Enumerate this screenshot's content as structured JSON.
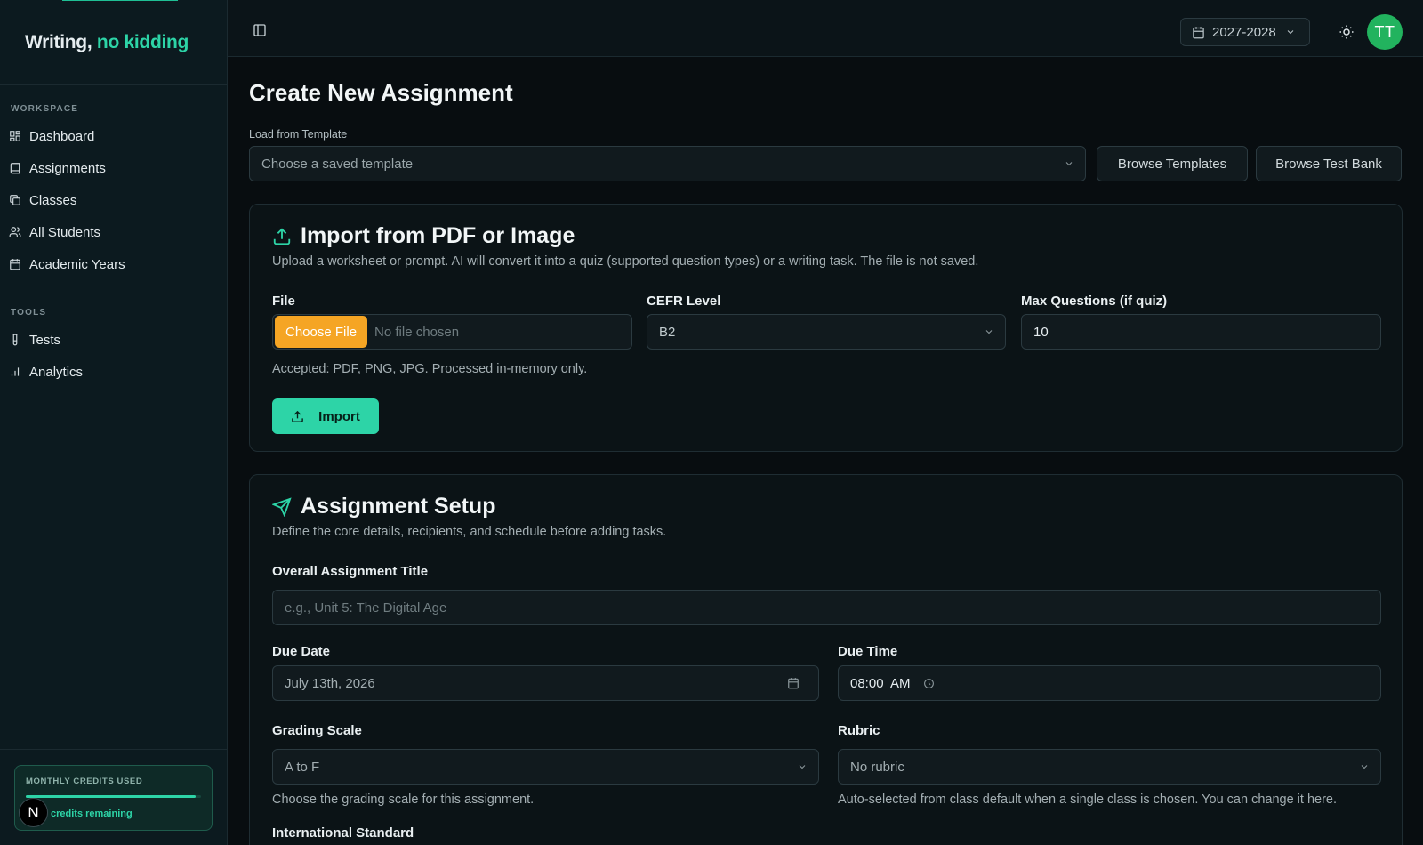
{
  "brand": {
    "text": "Writing,",
    "accent": "no kidding",
    "accent_color": "#2dd4a7"
  },
  "sidebar": {
    "workspace_label": "WORKSPACE",
    "workspace_items": [
      {
        "label": "Dashboard",
        "icon": "dashboard-icon"
      },
      {
        "label": "Assignments",
        "icon": "book-icon"
      },
      {
        "label": "Classes",
        "icon": "copy-icon"
      },
      {
        "label": "All Students",
        "icon": "users-icon"
      },
      {
        "label": "Academic Years",
        "icon": "calendar-icon"
      }
    ],
    "tools_label": "TOOLS",
    "tools_items": [
      {
        "label": "Tests",
        "icon": "test-tube-icon"
      },
      {
        "label": "Analytics",
        "icon": "bar-chart-icon"
      }
    ],
    "credits": {
      "label": "MONTHLY CREDITS USED",
      "remaining": "credits remaining",
      "used_fraction": 0.97
    },
    "user_initial": "N"
  },
  "header": {
    "academic_year": "2027-2028",
    "avatar_initials": "TT",
    "avatar_color": "#22b35e"
  },
  "page": {
    "title": "Create New Assignment",
    "template_label": "Load from Template",
    "template_placeholder": "Choose a saved template",
    "browse_templates": "Browse Templates",
    "browse_test_bank": "Browse Test Bank"
  },
  "import_card": {
    "title": "Import from PDF or Image",
    "description": "Upload a worksheet or prompt. AI will convert it into a quiz (supported question types) or a writing task. The file is not saved.",
    "file_label": "File",
    "choose_file": "Choose File",
    "no_file": "No file chosen",
    "cefr_label": "CEFR Level",
    "cefr_value": "B2",
    "max_q_label": "Max Questions (if quiz)",
    "max_q_value": "10",
    "accepted": "Accepted: PDF, PNG, JPG. Processed in-memory only.",
    "import_button": "Import"
  },
  "setup_card": {
    "title": "Assignment Setup",
    "description": "Define the core details, recipients, and schedule before adding tasks.",
    "title_label": "Overall Assignment Title",
    "title_placeholder": "e.g., Unit 5: The Digital Age",
    "due_date_label": "Due Date",
    "due_date_value": "July 13th, 2026",
    "due_time_label": "Due Time",
    "due_time_value": "08:00  AM",
    "grading_label": "Grading Scale",
    "grading_value": "A to F",
    "grading_help": "Choose the grading scale for this assignment.",
    "rubric_label": "Rubric",
    "rubric_value": "No rubric",
    "rubric_help": "Auto-selected from class default when a single class is chosen. You can change it here.",
    "intl_label": "International Standard"
  }
}
